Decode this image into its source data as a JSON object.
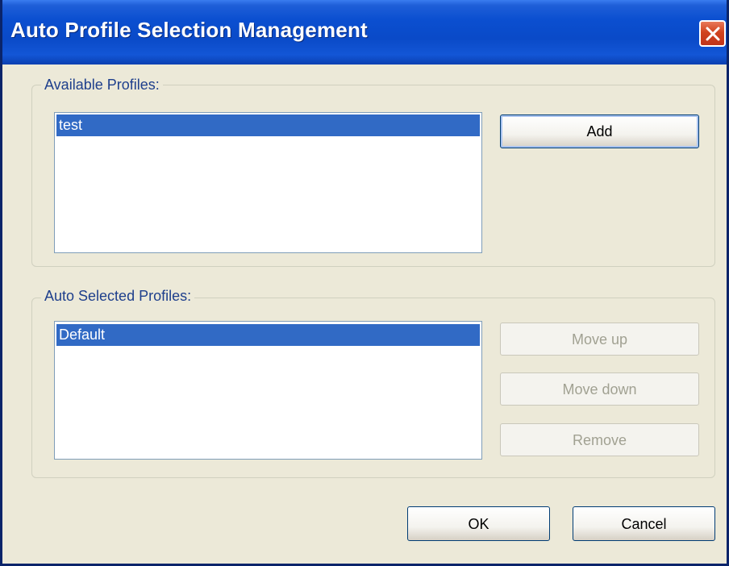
{
  "window": {
    "title": "Auto Profile Selection Management",
    "close_icon": "close-icon"
  },
  "available_profiles": {
    "label": "Available Profiles:",
    "items": [
      "test"
    ],
    "selected_index": 0,
    "add_label": "Add"
  },
  "auto_selected_profiles": {
    "label": "Auto Selected Profiles:",
    "items": [
      "Default"
    ],
    "selected_index": 0,
    "move_up_label": "Move up",
    "move_down_label": "Move down",
    "remove_label": "Remove"
  },
  "footer": {
    "ok_label": "OK",
    "cancel_label": "Cancel"
  },
  "colors": {
    "titlebar": "#0a4ac8",
    "selection": "#316ac5",
    "dialog_background": "#ece9d8",
    "close_button": "#d1431f",
    "group_label": "#1e3f8c"
  }
}
